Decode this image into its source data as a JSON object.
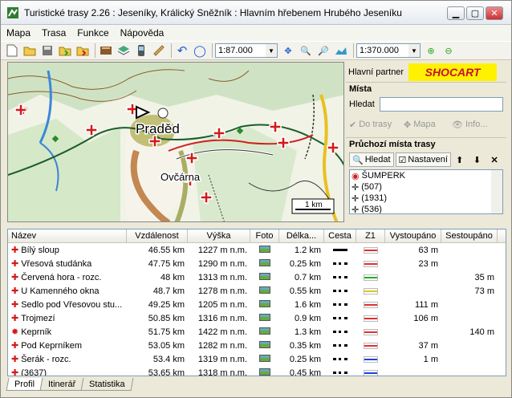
{
  "window": {
    "title": "Turistické trasy 2.26 : Jeseníky, Králický Sněžník : Hlavním hřebenem Hrubého Jeseníku"
  },
  "menu": [
    "Mapa",
    "Trasa",
    "Funkce",
    "Nápověda"
  ],
  "toolbar": {
    "scale1": "1:87.000",
    "scale2": "1:370.000"
  },
  "map": {
    "labels": {
      "peak": "Praděd",
      "hut": "Ovčárna",
      "scale": "1 km"
    }
  },
  "panel": {
    "partner_label": "Hlavní partner",
    "partner_logo": "SHOCART",
    "places_title": "Místa",
    "search_label": "Hledat",
    "search_value": "",
    "buttons": [
      "Do trasy",
      "Mapa",
      "Info..."
    ],
    "route_title": "Průchozí místa trasy",
    "route_buttons": [
      "Hledat",
      "Nastavení"
    ],
    "route_items": [
      "ŠUMPERK",
      "(507)",
      "(1931)",
      "(536)"
    ]
  },
  "grid": {
    "columns": [
      "Název",
      "Vzdálenost",
      "Výška",
      "Foto",
      "Délka...",
      "Cesta",
      "Z1",
      "Vystoupáno",
      "Sestoupáno"
    ],
    "rows": [
      {
        "name": "Bílý sloup",
        "dist": "46.55 km",
        "alt": "1227 m n.m.",
        "len": "1.2 km",
        "path": "solid",
        "mark": "#e03030",
        "up": "63 m",
        "down": ""
      },
      {
        "name": "Vřesová studánka",
        "dist": "47.75 km",
        "alt": "1290 m n.m.",
        "len": "0.25 km",
        "path": "dotted",
        "mark": "#e03030",
        "up": "23 m",
        "down": ""
      },
      {
        "name": "Červená hora - rozc.",
        "dist": "48 km",
        "alt": "1313 m n.m.",
        "len": "0.7 km",
        "path": "dotted",
        "mark": "#20b020",
        "up": "",
        "down": "35 m"
      },
      {
        "name": "U Kamenného okna",
        "dist": "48.7 km",
        "alt": "1278 m n.m.",
        "len": "0.55 km",
        "path": "dotted",
        "mark": "#e8c020",
        "up": "",
        "down": "73 m"
      },
      {
        "name": "Sedlo pod Vřesovou stu...",
        "dist": "49.25 km",
        "alt": "1205 m n.m.",
        "len": "1.6 km",
        "path": "dotted",
        "mark": "#e03030",
        "up": "111 m",
        "down": ""
      },
      {
        "name": "Trojmezí",
        "dist": "50.85 km",
        "alt": "1316 m n.m.",
        "len": "0.9 km",
        "path": "dotted",
        "mark": "#e03030",
        "up": "106 m",
        "down": ""
      },
      {
        "name": "Keprník",
        "dist": "51.75 km",
        "alt": "1422 m n.m.",
        "len": "1.3 km",
        "path": "dotted",
        "mark": "#e03030",
        "up": "",
        "down": "140 m"
      },
      {
        "name": "Pod Keprníkem",
        "dist": "53.05 km",
        "alt": "1282 m n.m.",
        "len": "0.35 km",
        "path": "dotted",
        "mark": "#e03030",
        "up": "37 m",
        "down": ""
      },
      {
        "name": "Šerák - rozc.",
        "dist": "53.4 km",
        "alt": "1319 m n.m.",
        "len": "0.25 km",
        "path": "dotted",
        "mark": "#2040e0",
        "up": "1 m",
        "down": ""
      },
      {
        "name": "(3637)",
        "dist": "53.65 km",
        "alt": "1318 m n.m.",
        "len": "0.45 km",
        "path": "dotted",
        "mark": "#2040e0",
        "up": "",
        "down": ""
      }
    ]
  },
  "tabs": [
    "Profil",
    "Itinerář",
    "Statistika"
  ]
}
